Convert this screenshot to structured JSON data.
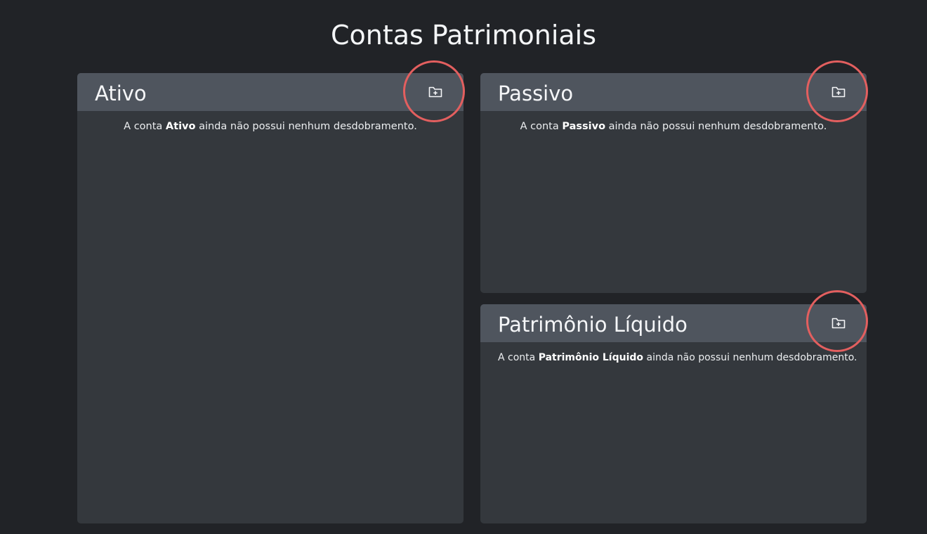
{
  "page": {
    "title": "Contas Patrimoniais"
  },
  "colors": {
    "background": "#212327",
    "card_body": "#34383d",
    "card_header": "#4f555e",
    "highlight": "#e35f5f"
  },
  "cards": [
    {
      "id": "ativo",
      "title": "Ativo",
      "add_icon": "folder-plus-icon",
      "empty_prefix": "A conta",
      "account_name": "Ativo",
      "empty_suffix": "ainda não possui nenhum desdobramento."
    },
    {
      "id": "passivo",
      "title": "Passivo",
      "add_icon": "folder-plus-icon",
      "empty_prefix": "A conta",
      "account_name": "Passivo",
      "empty_suffix": "ainda não possui nenhum desdobramento."
    },
    {
      "id": "patrimonio-liquido",
      "title": "Patrimônio Líquido",
      "add_icon": "folder-plus-icon",
      "empty_prefix": "A conta",
      "account_name": "Patrimônio Líquido",
      "empty_suffix": "ainda não possui nenhum desdobramento."
    }
  ]
}
